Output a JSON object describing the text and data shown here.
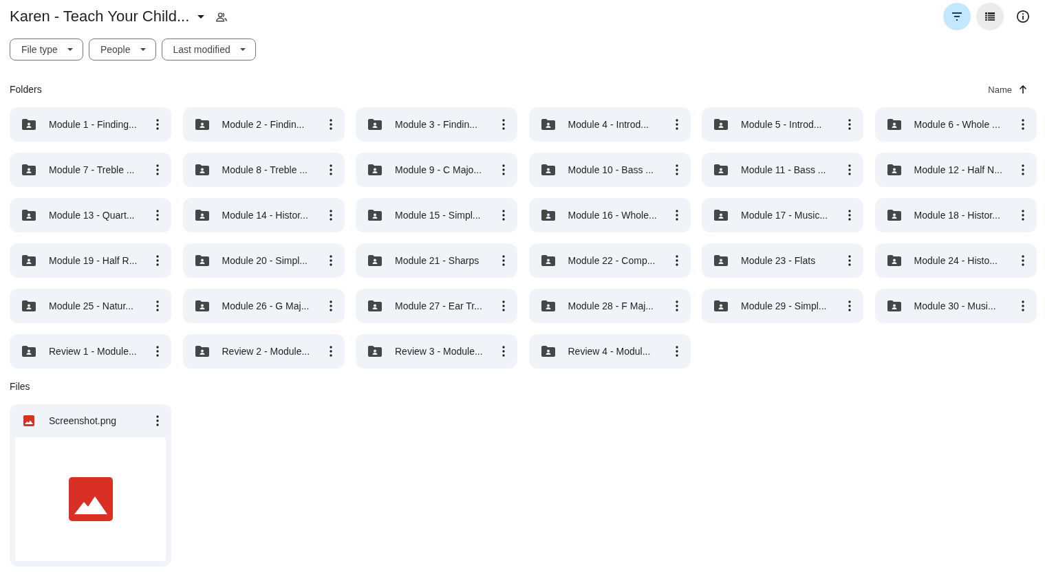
{
  "header": {
    "title": "Karen - Teach Your Child...",
    "toolbar": [
      {
        "kind": "filter",
        "selected": true
      },
      {
        "kind": "list",
        "selected": false
      },
      {
        "kind": "info",
        "selected": false
      }
    ]
  },
  "filters": [
    "File type",
    "People",
    "Last modified"
  ],
  "folders": {
    "heading": "Folders",
    "sort": "Name",
    "items": [
      "Module 1 - Finding...",
      "Module 2 - Findin...",
      "Module 3 - Findin...",
      "Module 4 - Introd...",
      "Module 5 - Introd...",
      "Module 6 - Whole ...",
      "Module 7 - Treble ...",
      "Module 8 - Treble ...",
      "Module 9 - C Majo...",
      "Module 10 - Bass ...",
      "Module 11 - Bass ...",
      "Module 12 - Half N...",
      "Module 13 - Quart...",
      "Module 14 - Histor...",
      "Module 15 - Simpl...",
      "Module 16 - Whole...",
      "Module 17 - Music...",
      "Module 18 - Histor...",
      "Module 19 - Half R...",
      "Module 20 - Simpl...",
      "Module 21 - Sharps",
      "Module 22 - Comp...",
      "Module 23 - Flats",
      "Module 24 - Histo...",
      "Module 25 - Natur...",
      "Module 26 - G Maj...",
      "Module 27 - Ear Tr...",
      "Module 28 - F Maj...",
      "Module 29 - Simpl...",
      "Module 30 - Musi...",
      "Review 1 - Module...",
      "Review 2 - Module...",
      "Review 3 - Module...",
      "Review 4 - Modul..."
    ]
  },
  "files": {
    "heading": "Files",
    "items": [
      {
        "name": "Screenshot.png",
        "kind": "image"
      }
    ]
  }
}
